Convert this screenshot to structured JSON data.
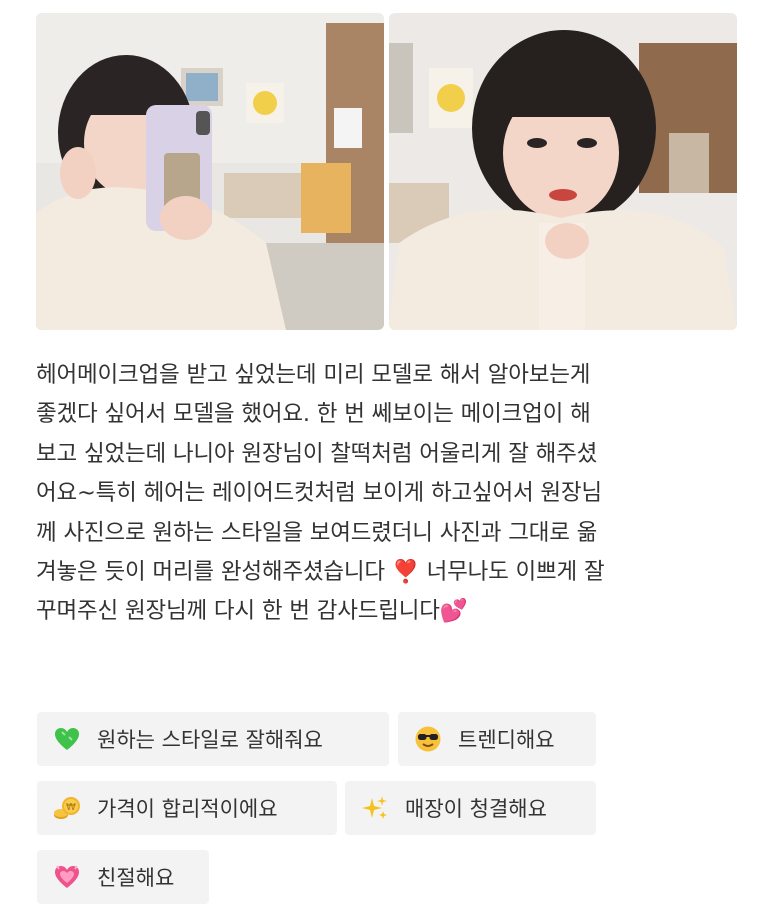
{
  "photos": [
    {
      "name": "review-photo-1"
    },
    {
      "name": "review-photo-2"
    }
  ],
  "review": {
    "text": "헤어메이크업을 받고 싶었는데 미리 모델로 해서 알아보는게\n좋겠다 싶어서 모델을 했어요. 한 번 쎄보이는 메이크업이 해\n보고 싶었는데 나니아 원장님이 찰떡처럼 어울리게 잘 해주셨\n어요~특히 헤어는 레이어드컷처럼 보이게 하고싶어서 원장님\n께 사진으로 원하는 스타일을 보여드렸더니 사진과 그대로 옮\n겨놓은 듯이 머리를 완성해주셨습니다 ❣️ 너무나도 이쁘게 잘\n꾸며주신 원장님께 다시 한 번 감사드립니다💕"
  },
  "tags": [
    {
      "label": "원하는 스타일로 잘해줘요",
      "icon": "green-heart-icon"
    },
    {
      "label": "트렌디해요",
      "icon": "sunglasses-face-icon"
    },
    {
      "label": "가격이 합리적이에요",
      "icon": "coins-icon"
    },
    {
      "label": "매장이 청결해요",
      "icon": "sparkles-icon"
    },
    {
      "label": "친절해요",
      "icon": "pink-heart-icon"
    }
  ],
  "colors": {
    "tag_bg": "#f3f3f3",
    "text": "#333333"
  }
}
